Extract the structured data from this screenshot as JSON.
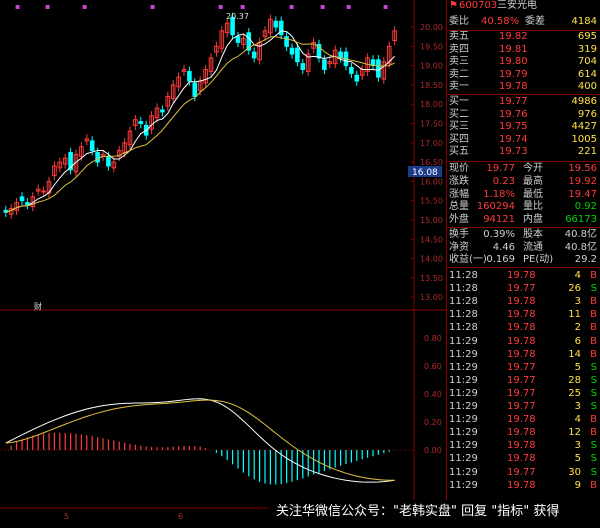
{
  "colors": {
    "up": "#ff3b3b",
    "down": "#00ffff",
    "ma1": "#ffffff",
    "ma2": "#e0c040",
    "axis": "#8a0000"
  },
  "chart": {
    "price_ticks": [
      "20.00",
      "19.50",
      "19.00",
      "18.50",
      "18.00",
      "17.50",
      "17.00",
      "16.50",
      "16.00",
      "15.50",
      "15.00",
      "14.50",
      "14.00",
      "13.50",
      "13.00"
    ],
    "high_label": "20.37",
    "current_price_tag": "16.08",
    "event_marker": "财",
    "macd_ticks": [
      "0.80",
      "0.60",
      "0.40",
      "0.20",
      "0.00"
    ],
    "bottom_labels": [
      "5",
      "6"
    ]
  },
  "stock": {
    "icon": "stock-flag-icon",
    "code": "600703",
    "name": "三安光电"
  },
  "ratio": {
    "label1": "委比",
    "value1": "40.58%",
    "label2": "委差",
    "value2": "4184"
  },
  "asks": [
    {
      "label": "卖五",
      "price": "19.82",
      "vol": "695"
    },
    {
      "label": "卖四",
      "price": "19.81",
      "vol": "319"
    },
    {
      "label": "卖三",
      "price": "19.80",
      "vol": "704"
    },
    {
      "label": "卖二",
      "price": "19.79",
      "vol": "614"
    },
    {
      "label": "卖一",
      "price": "19.78",
      "vol": "400"
    }
  ],
  "bids": [
    {
      "label": "买一",
      "price": "19.77",
      "vol": "4986"
    },
    {
      "label": "买二",
      "price": "19.76",
      "vol": "976"
    },
    {
      "label": "买三",
      "price": "19.75",
      "vol": "4427"
    },
    {
      "label": "买四",
      "price": "19.74",
      "vol": "1005"
    },
    {
      "label": "买五",
      "price": "19.73",
      "vol": "221"
    }
  ],
  "quote": [
    {
      "l1": "现价",
      "v1": "19.77",
      "l2": "今开",
      "v2": "19.56"
    },
    {
      "l1": "涨跌",
      "v1": "0.23",
      "l2": "最高",
      "v2": "19.92"
    },
    {
      "l1": "涨幅",
      "v1": "1.18%",
      "l2": "最低",
      "v2": "19.47"
    },
    {
      "l1": "总量",
      "v1": "160294",
      "l2": "量比",
      "v2": "0.92"
    },
    {
      "l1": "外盘",
      "v1": "94121",
      "l2": "内盘",
      "v2": "66173"
    }
  ],
  "fund": [
    {
      "l1": "换手",
      "v1": "0.39%",
      "l2": "股本",
      "v2": "40.8亿"
    },
    {
      "l1": "净资",
      "v1": "4.46",
      "l2": "流通",
      "v2": "40.8亿"
    },
    {
      "l1": "收益(一)",
      "v1": "0.169",
      "l2": "PE(动)",
      "v2": "29.2"
    }
  ],
  "ticks": [
    {
      "time": "11:28",
      "price": "19.78",
      "vol": "4",
      "side": "B"
    },
    {
      "time": "11:28",
      "price": "19.77",
      "vol": "26",
      "side": "S"
    },
    {
      "time": "11:28",
      "price": "19.78",
      "vol": "3",
      "side": "B"
    },
    {
      "time": "11:28",
      "price": "19.78",
      "vol": "11",
      "side": "B"
    },
    {
      "time": "11:28",
      "price": "19.78",
      "vol": "2",
      "side": "B"
    },
    {
      "time": "11:29",
      "price": "19.78",
      "vol": "6",
      "side": "B"
    },
    {
      "time": "11:29",
      "price": "19.78",
      "vol": "14",
      "side": "B"
    },
    {
      "time": "11:29",
      "price": "19.77",
      "vol": "5",
      "side": "S"
    },
    {
      "time": "11:29",
      "price": "19.77",
      "vol": "28",
      "side": "S"
    },
    {
      "time": "11:29",
      "price": "19.77",
      "vol": "25",
      "side": "S"
    },
    {
      "time": "11:29",
      "price": "19.77",
      "vol": "3",
      "side": "S"
    },
    {
      "time": "11:29",
      "price": "19.78",
      "vol": "4",
      "side": "B"
    },
    {
      "time": "11:29",
      "price": "19.78",
      "vol": "12",
      "side": "B"
    },
    {
      "time": "11:29",
      "price": "19.78",
      "vol": "3",
      "side": "S"
    },
    {
      "time": "11:29",
      "price": "19.78",
      "vol": "5",
      "side": "S"
    },
    {
      "time": "11:29",
      "price": "19.77",
      "vol": "30",
      "side": "S"
    },
    {
      "time": "11:29",
      "price": "19.78",
      "vol": "9",
      "side": "B"
    }
  ],
  "footer": {
    "text": "关注华微信公众号：\"老韩实盘\" 回复 \"指标\" 获得"
  }
}
